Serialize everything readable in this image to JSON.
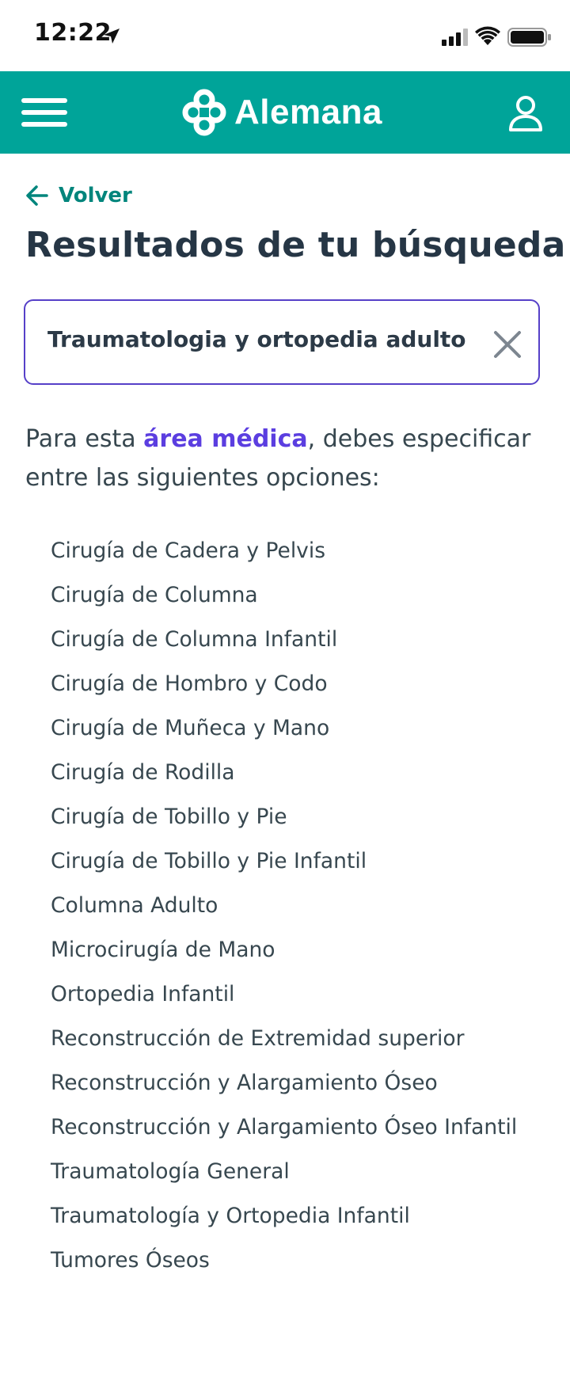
{
  "status_bar": {
    "time": "12:22"
  },
  "header": {
    "logo_text": "Alemana",
    "icons": [
      "menu-icon",
      "logo-mark-icon",
      "user-icon"
    ],
    "background_color": "#00a499"
  },
  "nav": {
    "back_label": "Volver"
  },
  "page": {
    "title": "Resultados de tu búsqueda"
  },
  "search": {
    "query": "Traumatologia y ortopedia adulto"
  },
  "info": {
    "prefix": "Para esta ",
    "link": "área médica",
    "suffix": ", debes especificar entre las siguientes opciones:",
    "link_color": "#5b3ee0"
  },
  "options": [
    "Cirugía de Cadera y Pelvis",
    "Cirugía de Columna",
    "Cirugía de Columna Infantil",
    "Cirugía de Hombro y Codo",
    "Cirugía de Muñeca y Mano",
    "Cirugía de Rodilla",
    "Cirugía de Tobillo y Pie",
    "Cirugía de Tobillo y Pie Infantil",
    "Columna Adulto",
    "Microcirugía de Mano",
    "Ortopedia Infantil",
    "Reconstrucción de Extremidad superior",
    "Reconstrucción y Alargamiento Óseo",
    "Reconstrucción y Alargamiento Óseo Infantil",
    "Traumatología General",
    "Traumatología y Ortopedia Infantil",
    "Tumores Óseos"
  ]
}
